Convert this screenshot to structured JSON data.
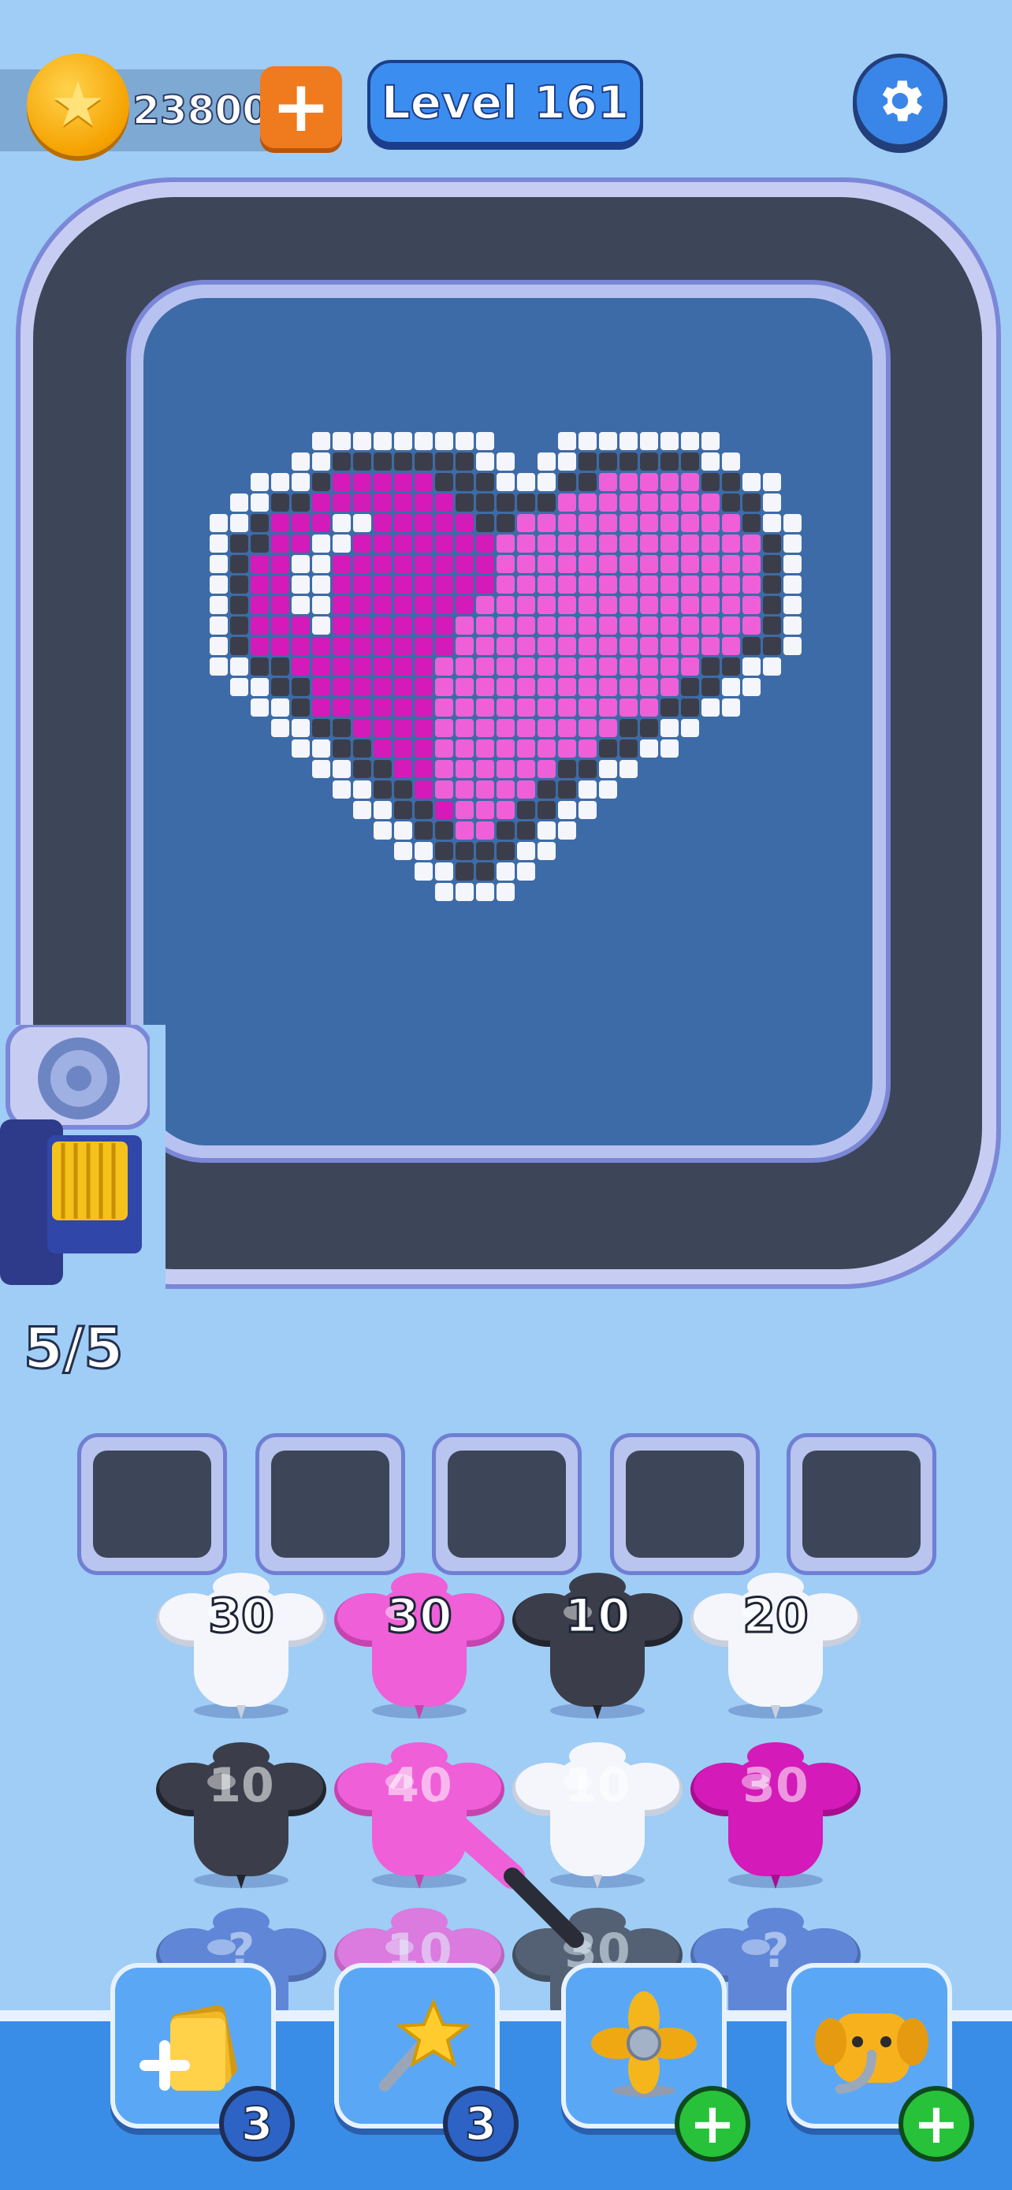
{
  "header": {
    "coins": "23800",
    "add_coins_label": "+",
    "level_label": "Level 161",
    "settings_icon": "gear-icon"
  },
  "board": {
    "picture": "heart",
    "colors": {
      "white": "#f4f6fb",
      "black": "#3b3e4a",
      "magenta": "#d41ab8",
      "pink": "#ef5fd8",
      "blue_bg": "#3d6ba7"
    }
  },
  "progress": {
    "text": "5/5"
  },
  "slots": {
    "count": 5
  },
  "queue": {
    "rows": [
      [
        {
          "color": "white",
          "count": "30"
        },
        {
          "color": "pink",
          "count": "30"
        },
        {
          "color": "black",
          "count": "10"
        },
        {
          "color": "white",
          "count": "20"
        }
      ],
      [
        {
          "color": "black",
          "count": "10"
        },
        {
          "color": "pink",
          "count": "40"
        },
        {
          "color": "white",
          "count": "10"
        },
        {
          "color": "magenta",
          "count": "30"
        }
      ],
      [
        {
          "color": "blue",
          "count": "?"
        },
        {
          "color": "pink",
          "count": "10"
        },
        {
          "color": "black",
          "count": "30"
        },
        {
          "color": "blue",
          "count": "?"
        }
      ]
    ]
  },
  "toolbar": {
    "tools": [
      {
        "name": "add-slot",
        "icon": "add-cards-icon",
        "badge": "3",
        "badge_type": "count"
      },
      {
        "name": "magic-wand",
        "icon": "magic-wand-icon",
        "badge": "3",
        "badge_type": "count"
      },
      {
        "name": "fan",
        "icon": "fan-icon",
        "badge": "+",
        "badge_type": "plus"
      },
      {
        "name": "elephant",
        "icon": "elephant-icon",
        "badge": "+",
        "badge_type": "plus"
      }
    ]
  }
}
